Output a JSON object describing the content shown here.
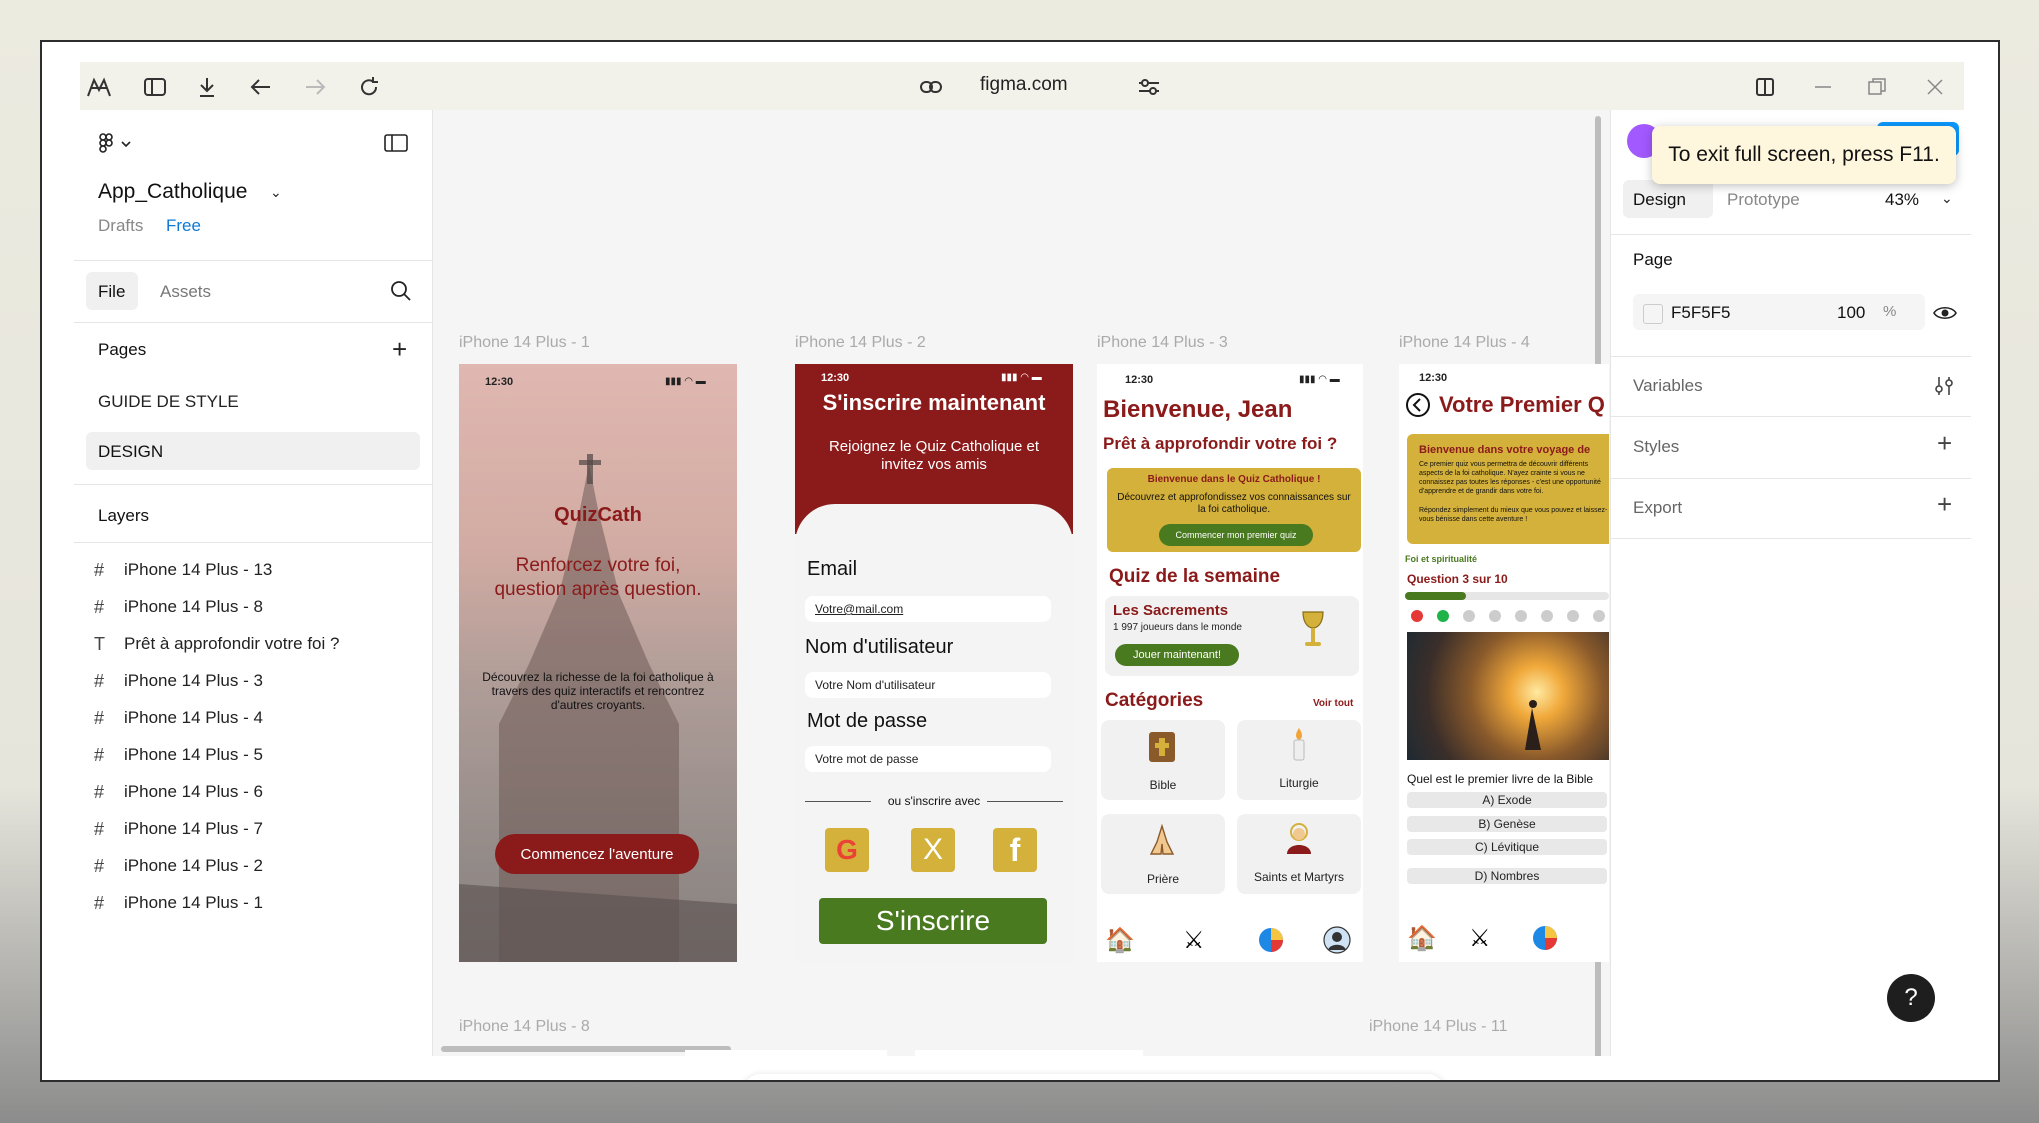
{
  "browser": {
    "url": "figma.com"
  },
  "file": {
    "name": "App_Catholique",
    "location": "Drafts",
    "plan": "Free",
    "tabs": [
      "File",
      "Assets"
    ]
  },
  "pages": {
    "title": "Pages",
    "items": [
      "GUIDE DE STYLE",
      "DESIGN"
    ]
  },
  "layers": {
    "title": "Layers",
    "items": [
      {
        "type": "frame",
        "label": "iPhone 14 Plus - 13"
      },
      {
        "type": "frame",
        "label": "iPhone 14 Plus - 8"
      },
      {
        "type": "text",
        "label": "Prêt à approfondir votre foi ?"
      },
      {
        "type": "frame",
        "label": "iPhone 14 Plus - 3"
      },
      {
        "type": "frame",
        "label": "iPhone 14 Plus - 4"
      },
      {
        "type": "frame",
        "label": "iPhone 14 Plus - 5"
      },
      {
        "type": "frame",
        "label": "iPhone 14 Plus - 6"
      },
      {
        "type": "frame",
        "label": "iPhone 14 Plus - 7"
      },
      {
        "type": "frame",
        "label": "iPhone 14 Plus - 2"
      },
      {
        "type": "frame",
        "label": "iPhone 14 Plus - 1"
      }
    ]
  },
  "canvas": {
    "frame_labels": [
      "iPhone 14 Plus - 1",
      "iPhone 14 Plus - 2",
      "iPhone 14 Plus - 3",
      "iPhone 14 Plus - 4",
      "iPhone 14 Plus - 8",
      "iPhone 14 Plus - 11"
    ],
    "frame1": {
      "time": "12:30",
      "app_name": "QuizCath",
      "tagline": "Renforcez votre foi, question après question.",
      "description": "Découvrez la richesse de la foi catholique à travers des quiz interactifs et rencontrez d'autres croyants.",
      "cta": "Commencez l'aventure"
    },
    "frame2": {
      "time": "12:30",
      "title": "S'inscrire maintenant",
      "subtitle": "Rejoignez le Quiz Catholique et invitez vos amis",
      "email_label": "Email",
      "email_value": "Votre@mail.com",
      "username_label": "Nom d'utilisateur",
      "username_value": "Votre Nom d'utilisateur",
      "password_label": "Mot de passe",
      "password_value": "Votre mot de passe",
      "divider": "ou s'inscrire avec",
      "submit": "S'inscrire"
    },
    "frame3": {
      "time": "12:30",
      "greeting": "Bienvenue, Jean",
      "question": "Prêt à approfondir votre foi ?",
      "banner_title": "Bienvenue dans le Quiz Catholique !",
      "banner_text": "Découvrez et approfondissez vos connaissances sur la foi catholique.",
      "banner_button": "Commencer mon premier quiz",
      "weekly_title": "Quiz de la semaine",
      "weekly_name": "Les Sacrements",
      "weekly_players": "1 997 joueurs dans le monde",
      "weekly_button": "Jouer maintenant!",
      "categories_title": "Catégories",
      "see_all": "Voir tout",
      "categories": [
        "Bible",
        "Liturgie",
        "Prière",
        "Saints et Martyrs"
      ]
    },
    "frame4": {
      "time": "12:30",
      "title": "Votre Premier Q",
      "banner_title": "Bienvenue dans votre voyage de",
      "banner_text": "Ce premier quiz vous permettra de découvrir différents aspects de la foi catholique. N'ayez crainte si vous ne connaissez pas toutes les réponses - c'est une opportunité d'apprendre et de grandir dans votre foi.",
      "banner_text2": "Répondez simplement du mieux que vous pouvez et laissez-vous bénisse dans cette aventure !",
      "category": "Foi et spiritualité",
      "progress": "Question 3 sur 10",
      "progress_fraction": 0.3,
      "question": "Quel est le premier livre de la Bible",
      "options": [
        "A) Exode",
        "B) Genèse",
        "C) Lévitique",
        "D) Nombres"
      ]
    }
  },
  "right_panel": {
    "tabs": [
      "Design",
      "Prototype"
    ],
    "zoom": "43%",
    "page_title": "Page",
    "page_color": "F5F5F5",
    "page_opacity": "100",
    "percent_sign": "%",
    "sections": [
      "Variables",
      "Styles",
      "Export"
    ]
  },
  "toast": {
    "text": "To exit full screen, press F11."
  },
  "help": {
    "label": "?"
  },
  "colors": {
    "brand_red": "#8b1a1a",
    "gold": "#d4b13a",
    "green": "#4a7a1f",
    "selected_tool": "#0d99ff"
  }
}
